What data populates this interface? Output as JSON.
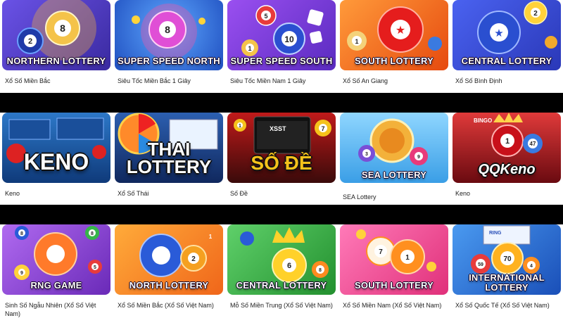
{
  "rows": [
    {
      "tiles": [
        {
          "banner": "NORTHERN LOTTERY",
          "caption": "Xổ Số Miền Bắc",
          "bg": "#4a3bb5",
          "accent": "#f4c34a",
          "balls": [
            "2",
            "8"
          ]
        },
        {
          "banner": "SUPER SPEED NORTH",
          "caption": "Siêu Tốc Miền Bắc 1 Giây",
          "bg": "#2b66d9",
          "accent": "#ff4fa3",
          "balls": [
            "8"
          ]
        },
        {
          "banner": "SUPER SPEED SOUTH",
          "caption": "Siêu Tốc Miền Nam 1 Giây",
          "bg": "#7a3de0",
          "accent": "#ff5a5a",
          "balls": [
            "5",
            "10",
            "1"
          ]
        },
        {
          "banner": "SOUTH LOTTERY",
          "caption": "Xổ Số An Giang",
          "bg": "#ff6a1a",
          "accent": "#e51d1d",
          "balls": [
            "1",
            "★"
          ]
        },
        {
          "banner": "CENTRAL LOTTERY",
          "caption": "Xổ Số Bình Định",
          "bg": "#3b50e0",
          "accent": "#ffd23a",
          "balls": [
            "★",
            "2"
          ]
        }
      ]
    },
    {
      "tiles": [
        {
          "banner": "KENO",
          "caption": "Keno",
          "bg": "#1d5aa8",
          "accent": "#d22",
          "balls": []
        },
        {
          "banner": "THAI LOTTERY",
          "caption": "Xổ Số Thái",
          "bg": "#1a3f86",
          "accent": "#ff8a2a",
          "balls": []
        },
        {
          "banner": "SỐ ĐỀ",
          "caption": "Số Đề",
          "bg": "#2b2b2b",
          "accent": "#f5c21b",
          "balls": [
            "7",
            "1"
          ],
          "screen_text": "XSST"
        },
        {
          "banner": "SEA LOTTERY",
          "caption": "SEA Lottery",
          "bg": "#4fb6f0",
          "accent": "#f3b13a",
          "balls": [
            "3",
            "9"
          ]
        },
        {
          "banner": "QQKeno",
          "caption": "Keno",
          "bg": "#b3121c",
          "accent": "#ffd34a",
          "balls": [
            "1",
            "47"
          ],
          "top_text": "BINGO"
        }
      ]
    },
    {
      "tiles": [
        {
          "banner": "RNG GAME",
          "caption": "Sinh Số Ngẫu Nhiên (Xổ Số Việt Nam)",
          "bg": "#8a3fd6",
          "accent": "#ff7a2a",
          "balls": [
            "8",
            "9",
            "5",
            "8"
          ]
        },
        {
          "banner": "NORTH LOTTERY",
          "caption": "Xổ Số Miền Bắc (Xổ Số Việt Nam)",
          "bg": "#ff8a1f",
          "accent": "#2a5bd8",
          "balls": [
            "2",
            "1"
          ]
        },
        {
          "banner": "CENTRAL LOTTERY",
          "caption": "Mỗ Số Miền Trung (Xổ Số Việt Nam)",
          "bg": "#35b54a",
          "accent": "#ffd12a",
          "balls": [
            "6",
            "8"
          ]
        },
        {
          "banner": "SOUTH LOTTERY",
          "caption": "Xổ Số Miền Nam (Xổ Số Việt Nam)",
          "bg": "#ff4f9a",
          "accent": "#ff8f1f",
          "balls": [
            "7",
            "1"
          ]
        },
        {
          "banner": "INTERNATIONAL LOTTERY",
          "caption": "Xổ Số Quốc Tế (Xổ Số Việt Nam)",
          "bg": "#2a78e0",
          "accent": "#ffb21f",
          "balls": [
            "59",
            "70",
            "4"
          ],
          "top_text": "RING"
        }
      ]
    }
  ]
}
